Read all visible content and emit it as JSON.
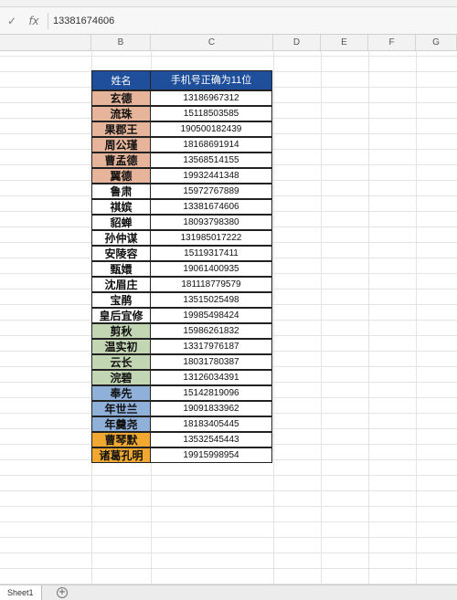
{
  "formula_bar": {
    "confirm_icon": "check-icon",
    "fx_label": "fx",
    "content": "13381674606"
  },
  "columns": [
    "B",
    "C",
    "D",
    "E",
    "F",
    "G"
  ],
  "table": {
    "headers": {
      "name": "姓名",
      "phone": "手机号正确为11位"
    },
    "rows": [
      {
        "name": "玄德",
        "phone": "13186967312",
        "color": "#e6b49a"
      },
      {
        "name": "流珠",
        "phone": "15118503585",
        "color": "#e6b49a"
      },
      {
        "name": "果郡王",
        "phone": "190500182439",
        "color": "#e6b49a"
      },
      {
        "name": "周公瑾",
        "phone": "18168691914",
        "color": "#e6b49a"
      },
      {
        "name": "曹孟德",
        "phone": "13568514155",
        "color": "#e6b49a"
      },
      {
        "name": "翼德",
        "phone": "19932441348",
        "color": "#e6b49a"
      },
      {
        "name": "鲁肃",
        "phone": "15972767889",
        "color": "#ffffff"
      },
      {
        "name": "祺嫔",
        "phone": "13381674606",
        "color": "#ffffff"
      },
      {
        "name": "貂蝉",
        "phone": "18093798380",
        "color": "#ffffff"
      },
      {
        "name": "孙仲谋",
        "phone": "131985017222",
        "color": "#ffffff"
      },
      {
        "name": "安陵容",
        "phone": "15119317411",
        "color": "#ffffff"
      },
      {
        "name": "甄嬛",
        "phone": "19061400935",
        "color": "#ffffff"
      },
      {
        "name": "沈眉庄",
        "phone": "181118779579",
        "color": "#ffffff"
      },
      {
        "name": "宝鹃",
        "phone": "13515025498",
        "color": "#ffffff"
      },
      {
        "name": "皇后宜修",
        "phone": "19985498424",
        "color": "#ffffff"
      },
      {
        "name": "剪秋",
        "phone": "15986261832",
        "color": "#c3d6b4"
      },
      {
        "name": "温实初",
        "phone": "13317976187",
        "color": "#c3d6b4"
      },
      {
        "name": "云长",
        "phone": "18031780387",
        "color": "#c3d6b4"
      },
      {
        "name": "浣碧",
        "phone": "13126034391",
        "color": "#c3d6b4"
      },
      {
        "name": "奉先",
        "phone": "15142819096",
        "color": "#8fb0d9"
      },
      {
        "name": "年世兰",
        "phone": "19091833962",
        "color": "#8fb0d9"
      },
      {
        "name": "年羹尧",
        "phone": "18183405445",
        "color": "#8fb0d9"
      },
      {
        "name": "曹琴默",
        "phone": "13532545443",
        "color": "#f0a830"
      },
      {
        "name": "诸葛孔明",
        "phone": "19915998954",
        "color": "#f0a830"
      }
    ]
  },
  "sheet_tabs": {
    "active": "Sheet1",
    "add_icon": "plus-icon"
  },
  "colors": {
    "header_bg": "#1f4e9a",
    "header_text": "#ffffff"
  }
}
